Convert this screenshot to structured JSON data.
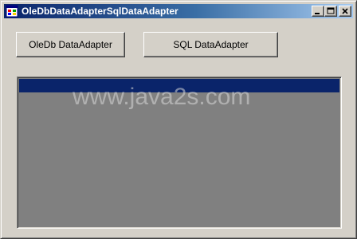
{
  "window": {
    "title": "OleDbDataAdapterSqlDataAdapter"
  },
  "buttons": {
    "oledb_label": "OleDb DataAdapter",
    "sql_label": "SQL DataAdapter"
  },
  "watermark": {
    "text": "www.java2s.com"
  },
  "colors": {
    "window_face": "#d4d0c8",
    "title_bar_start": "#0a246a",
    "title_bar_end": "#a6caf0",
    "grid_background": "#808080",
    "grid_caption": "#0a246a"
  },
  "icons": {
    "app": "windows-form-icon",
    "minimize": "minimize-icon",
    "maximize": "maximize-icon",
    "close": "close-icon"
  }
}
